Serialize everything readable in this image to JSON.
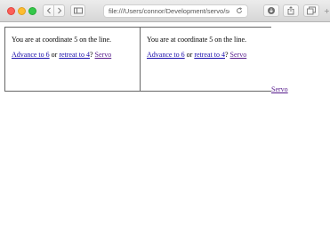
{
  "browser": {
    "url": "file:///Users/connor/Development/servo/servo",
    "buttons": [
      "back",
      "forward",
      "sidebar",
      "reload",
      "downloads",
      "share",
      "tabs",
      "new-tab"
    ]
  },
  "frames": [
    {
      "text": "You are at coordinate 5 on the line.",
      "advance_label": "Advance to 6",
      "connector": " or ",
      "retreat_label": "retreat to 4",
      "question": "?",
      "servo_label": "Servo"
    },
    {
      "text": "You are at coordinate 5 on the line.",
      "advance_label": "Advance to 6",
      "connector": " or ",
      "retreat_label": "retreat to 4",
      "question": "?",
      "servo_label": "Servo"
    }
  ],
  "outer_link": "Servo",
  "colors": {
    "link": "#1a0dab",
    "visited": "#551a8b"
  }
}
